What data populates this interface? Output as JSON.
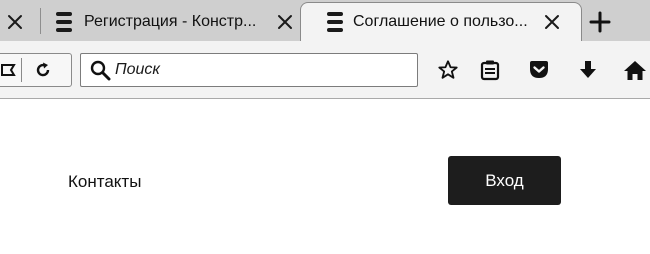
{
  "browser": {
    "tabs": [
      {
        "title": "",
        "active": false
      },
      {
        "title": "Регистрация - Констр...",
        "active": false
      },
      {
        "title": "Соглашение о пользо...",
        "active": true
      }
    ],
    "new_tab_label": "+",
    "search": {
      "placeholder": "Поиск",
      "value": ""
    },
    "icons": {
      "tab_close": "close-icon",
      "favicon": "page-icon",
      "reload": "reload-icon",
      "bookmarks": "bookmark-star-icon",
      "reading_list": "clipboard-icon",
      "pocket": "pocket-icon",
      "downloads": "download-icon",
      "home": "home-icon"
    }
  },
  "page": {
    "nav": {
      "contacts_label": "Контакты"
    },
    "login_label": "Вход"
  },
  "colors": {
    "tabstrip": "#cfcfcf",
    "toolbar": "#f3f3f3",
    "login_button_bg": "#1d1d1d",
    "login_button_text": "#ffffff"
  }
}
